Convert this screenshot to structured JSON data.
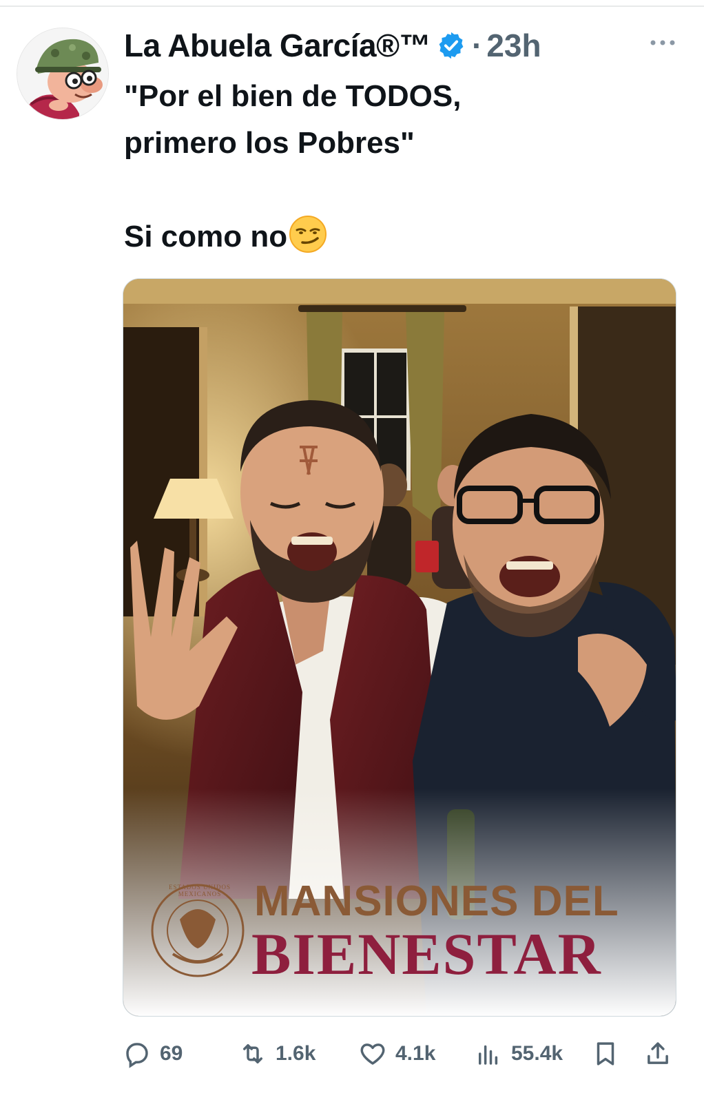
{
  "tweet": {
    "author_name": "La Abuela García®™",
    "timestamp": "23h",
    "text": "\"Por el bien de TODOS,\nprimero los Pobres\"\n\nSi como no"
  },
  "media": {
    "banner_line1": "MANSIONES DEL",
    "banner_line2": "BIENESTAR",
    "seal_text": "ESTADOS UNIDOS MEXICANOS"
  },
  "actions": {
    "replies": "69",
    "retweets": "1.6k",
    "likes": "4.1k",
    "views": "55.4k"
  },
  "icons": {
    "verified": "verified-badge-icon",
    "more": "more-options-icon",
    "reply": "reply-icon",
    "retweet": "retweet-icon",
    "like": "heart-icon",
    "views": "views-bar-chart-icon",
    "bookmark": "bookmark-icon",
    "share": "share-icon",
    "emoji": "smirking-face-emoji"
  },
  "colors": {
    "verified_blue": "#1d9bf0",
    "secondary_text": "#536471",
    "banner_brown": "#8a5a36",
    "banner_maroon": "#8e1f3e"
  }
}
